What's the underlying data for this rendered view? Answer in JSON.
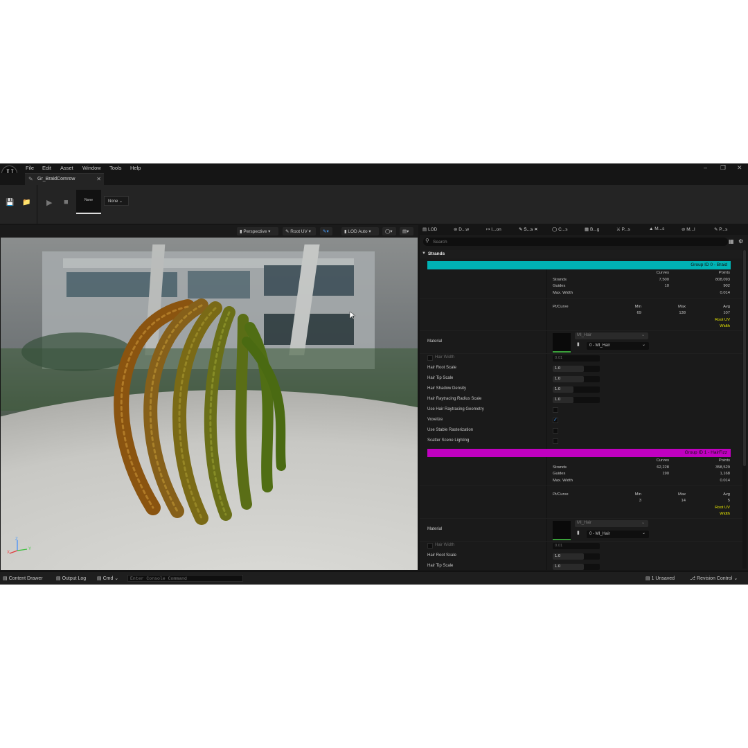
{
  "menu": {
    "file": "File",
    "edit": "Edit",
    "asset": "Asset",
    "window": "Window",
    "tools": "Tools",
    "help": "Help"
  },
  "document_tab": {
    "title": "Gr_BraidCornrow"
  },
  "toolbar": {
    "thumbnail_label": "None",
    "dropdown_value": "None"
  },
  "viewport": {
    "perspective": "Perspective",
    "view_mode": "Root UV",
    "lod": "LOD Auto",
    "axis_x": "X",
    "axis_y": "Y",
    "axis_z": "Z"
  },
  "details": {
    "tabs": [
      "LOD",
      "D...w",
      "I...on",
      "S...s",
      "C...s",
      "B...g",
      "P...s",
      "M...s",
      "M...l",
      "P...s"
    ],
    "search_placeholder": "Search",
    "category": "Strands",
    "groups": [
      {
        "banner": "Group ID 0 - Braid",
        "banner_color": "#00b2b4",
        "curves_header": "Curves",
        "points_header": "Points",
        "strands_label": "Strands",
        "strands_curves": "7,500",
        "strands_points": "808,093",
        "guides_label": "Guides",
        "guides_curves": "10",
        "guides_points": "902",
        "maxwidth_label": "Max. Width",
        "maxwidth_value": "0.014",
        "ptcurve_label": "Pt/Curve",
        "min_header": "Min",
        "max_header": "Max",
        "avg_header": "Avg",
        "min_value": "69",
        "max_value": "138",
        "avg_value": "107",
        "root_uv": "Root UV",
        "width": "Width",
        "material_label": "Material",
        "material_asset": "MI_Hair",
        "material_slot": "0 - MI_Hair",
        "hair_width_label": "Hair Width",
        "hair_width": "0.01",
        "root_scale_label": "Hair Root Scale",
        "root_scale": "1.0",
        "tip_scale_label": "Hair Tip Scale",
        "tip_scale": "1.0",
        "shadow_density_label": "Hair Shadow Density",
        "shadow_density": "1.0",
        "rt_radius_label": "Hair Raytracing Radius Scale",
        "rt_radius": "1.0",
        "use_rt_geom_label": "Use Hair Raytracing Geometry",
        "voxelize_label": "Voxelize",
        "stable_raster_label": "Use Stable Rasterization",
        "scatter_label": "Scatter Scene Lighting"
      },
      {
        "banner": "Group ID 1 - HairFizz",
        "banner_color": "#c000c0",
        "curves_header": "Curves",
        "points_header": "Points",
        "strands_label": "Strands",
        "strands_curves": "62,228",
        "strands_points": "358,529",
        "guides_label": "Guides",
        "guides_curves": "190",
        "guides_points": "1,168",
        "maxwidth_label": "Max. Width",
        "maxwidth_value": "0.014",
        "ptcurve_label": "Pt/Curve",
        "min_header": "Min",
        "max_header": "Max",
        "avg_header": "Avg",
        "min_value": "3",
        "max_value": "14",
        "avg_value": "5",
        "root_uv": "Root UV",
        "width": "Width",
        "material_label": "Material",
        "material_asset": "MI_Hair",
        "material_slot": "0 - MI_Hair",
        "hair_width_label": "Hair Width",
        "hair_width": "0.01",
        "root_scale_label": "Hair Root Scale",
        "root_scale": "1.0",
        "tip_scale_label": "Hair Tip Scale",
        "tip_scale": "1.0"
      }
    ]
  },
  "statusbar": {
    "content_drawer": "Content Drawer",
    "output_log": "Output Log",
    "cmd": "Cmd",
    "console_placeholder": "Enter Console Command",
    "unsaved": "1 Unsaved",
    "revision_control": "Revision Control"
  }
}
